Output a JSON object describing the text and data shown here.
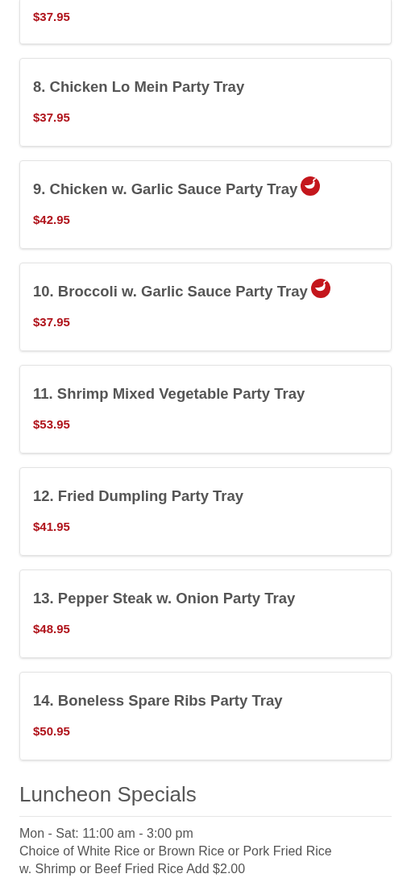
{
  "items": [
    {
      "kind": "partial",
      "price": "$37.95"
    },
    {
      "kind": "full",
      "name": "8. Chicken Lo Mein Party Tray",
      "spicy": false,
      "price": "$37.95"
    },
    {
      "kind": "full",
      "name": "9. Chicken w. Garlic Sauce Party Tray",
      "spicy": true,
      "price": "$42.95"
    },
    {
      "kind": "full",
      "name": "10. Broccoli w. Garlic Sauce Party Tray",
      "spicy": true,
      "price": "$37.95"
    },
    {
      "kind": "full",
      "name": "11. Shrimp Mixed Vegetable Party Tray",
      "spicy": false,
      "price": "$53.95"
    },
    {
      "kind": "full",
      "name": "12. Fried Dumpling Party Tray",
      "spicy": false,
      "price": "$41.95"
    },
    {
      "kind": "full",
      "name": "13. Pepper Steak w. Onion Party Tray",
      "spicy": false,
      "price": "$48.95"
    },
    {
      "kind": "full",
      "name": "14. Boneless Spare Ribs Party Tray",
      "spicy": false,
      "price": "$50.95"
    }
  ],
  "section": {
    "title": "Luncheon Specials",
    "lines": [
      "Mon - Sat: 11:00 am - 3:00 pm",
      "Choice of White Rice or Brown Rice or Pork Fried Rice",
      "w. Shrimp or Beef Fried Rice Add $2.00"
    ]
  }
}
